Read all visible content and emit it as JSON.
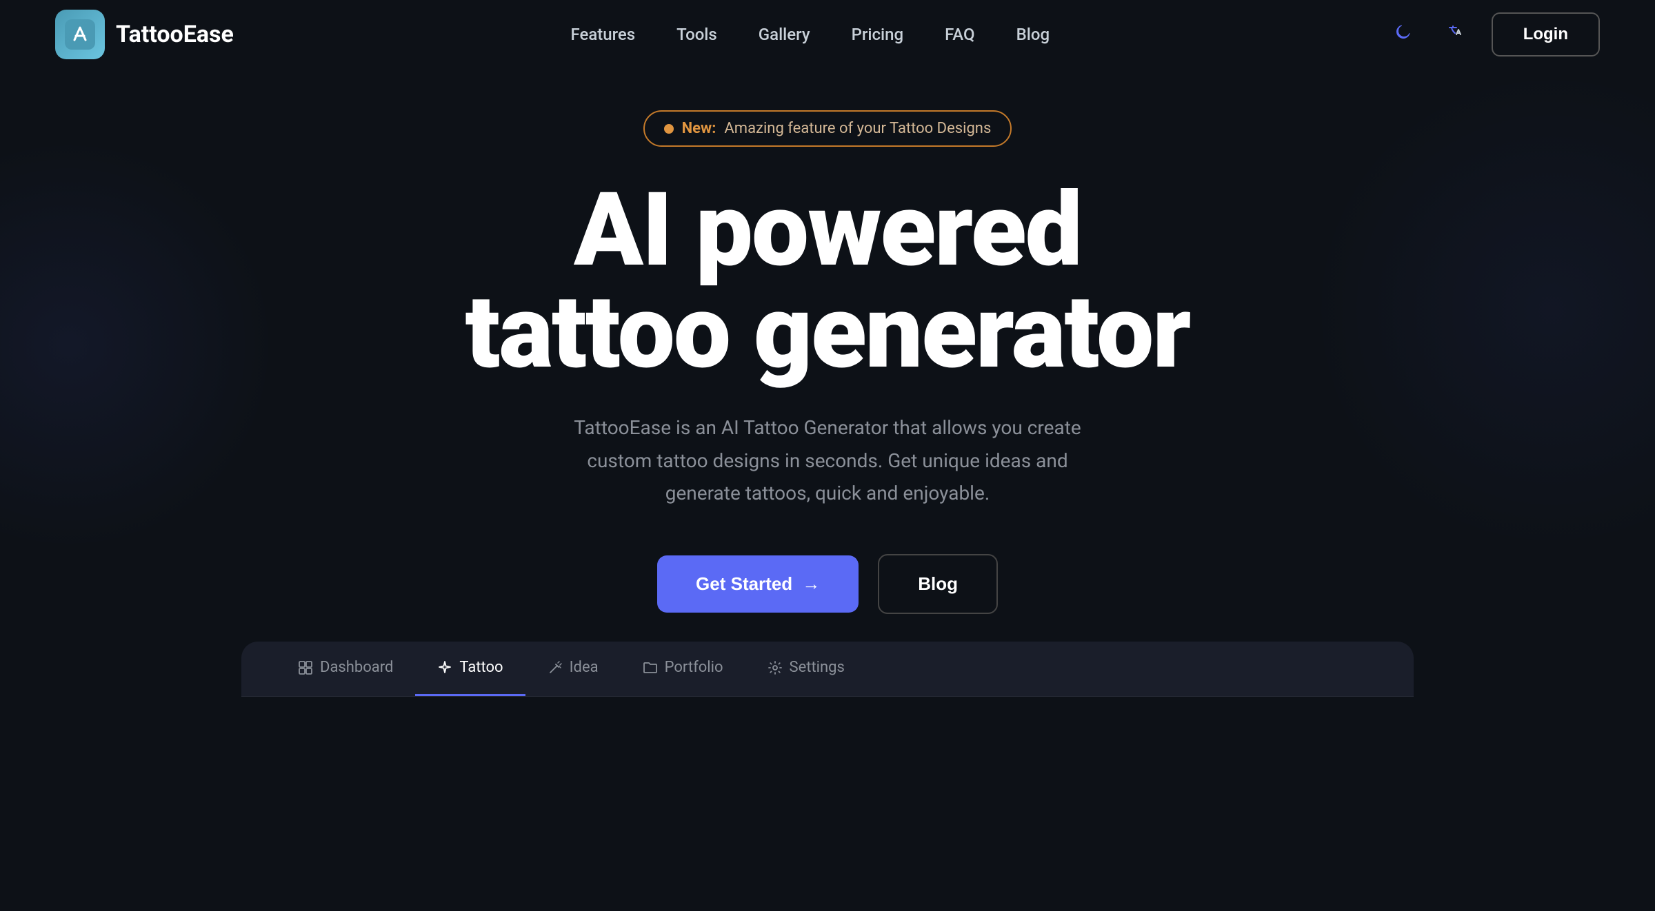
{
  "brand": {
    "name": "TattooEase",
    "logo_emoji": "🖊"
  },
  "nav": {
    "items": [
      {
        "label": "Features",
        "href": "#features"
      },
      {
        "label": "Tools",
        "href": "#tools"
      },
      {
        "label": "Gallery",
        "href": "#gallery"
      },
      {
        "label": "Pricing",
        "href": "#pricing"
      },
      {
        "label": "FAQ",
        "href": "#faq"
      },
      {
        "label": "Blog",
        "href": "#blog"
      }
    ]
  },
  "actions": {
    "login_label": "Login",
    "dark_mode_icon": "moon",
    "translate_icon": "translate"
  },
  "hero": {
    "badge_new": "New:",
    "badge_text": "Amazing feature of your Tattoo Designs",
    "title_line1": "AI powered",
    "title_line2": "tattoo generator",
    "subtitle": "TattooEase is an AI Tattoo Generator that allows you create custom tattoo designs in seconds. Get unique ideas and generate tattoos, quick and enjoyable.",
    "cta_primary": "Get Started",
    "cta_arrow": "→",
    "cta_secondary": "Blog"
  },
  "panel": {
    "tabs": [
      {
        "label": "Dashboard",
        "icon": "grid",
        "active": false
      },
      {
        "label": "Tattoo",
        "icon": "sparkle",
        "active": true
      },
      {
        "label": "Idea",
        "icon": "wand",
        "active": false
      },
      {
        "label": "Portfolio",
        "icon": "folder",
        "active": false
      },
      {
        "label": "Settings",
        "icon": "gear",
        "active": false
      }
    ]
  }
}
